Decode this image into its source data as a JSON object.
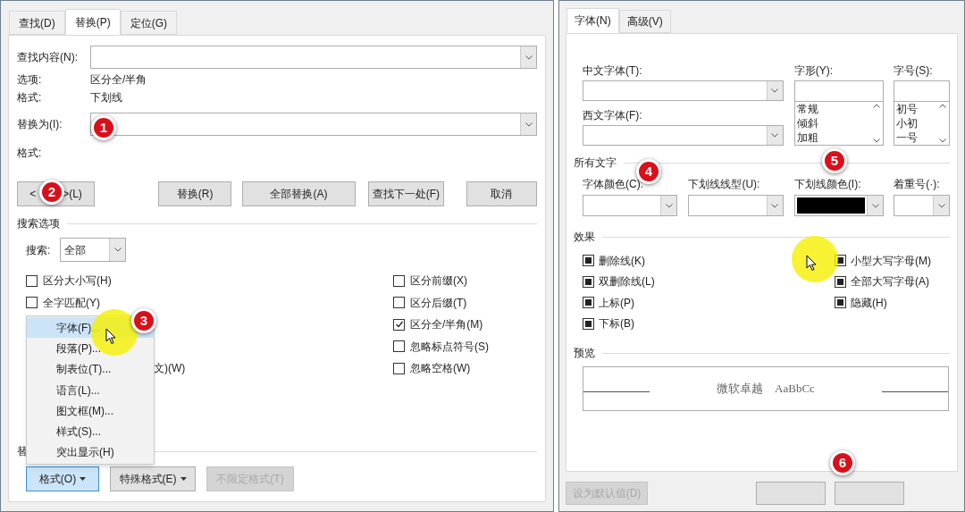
{
  "find_replace_dialog": {
    "tabs": [
      {
        "label": "查找(D)",
        "selected": false
      },
      {
        "label": "替换(P)",
        "selected": true
      },
      {
        "label": "定位(G)",
        "selected": false
      }
    ],
    "find_what": {
      "label": "查找内容(N):"
    },
    "options": {
      "label": "选项:",
      "value": "区分全/半角"
    },
    "format": {
      "label": "格式:",
      "value": "下划线"
    },
    "replace_with": {
      "label": "替换为(I):"
    },
    "replace_format": {
      "label": "格式:"
    },
    "more_button": [
      "<",
      ">(L)"
    ],
    "action_buttons": [
      "替换(R)",
      "全部替换(A)",
      "查找下一处(F)",
      "取消"
    ],
    "search_options_title": "搜索选项",
    "search": {
      "label": "搜索:",
      "value": "全部"
    },
    "left_options": [
      {
        "kind": "checkbox",
        "label": "区分大小写(H)",
        "checked": false
      },
      {
        "kind": "checkbox",
        "label": "全字匹配(Y)",
        "checked": false
      },
      {
        "kind": "partial",
        "label": "文)(W)"
      }
    ],
    "right_options": [
      {
        "label": "区分前缀(X)",
        "checked": false
      },
      {
        "label": "区分后缀(T)",
        "checked": false
      },
      {
        "label": "区分全/半角(M)",
        "checked": true
      },
      {
        "label": "忽略标点符号(S)",
        "checked": false
      },
      {
        "label": "忽略空格(W)",
        "checked": false
      }
    ],
    "replace_section_label": "替",
    "bottom_buttons": [
      {
        "label": "格式(O)",
        "kind": "menu",
        "pressed": true,
        "disabled": false
      },
      {
        "label": "特殊格式(E)",
        "kind": "menu",
        "pressed": false,
        "disabled": false
      },
      {
        "label": "不限定格式(T)",
        "kind": "plain",
        "pressed": false,
        "disabled": true
      }
    ],
    "format_menu": [
      {
        "label": "字体(F)...",
        "selected": true
      },
      {
        "label": "段落(P)...",
        "selected": false
      },
      {
        "label": "制表位(T)...",
        "selected": false
      },
      {
        "label": "语言(L)...",
        "selected": false
      },
      {
        "label": "图文框(M)...",
        "selected": false
      },
      {
        "label": "样式(S)...",
        "selected": false
      },
      {
        "label": "突出显示(H)",
        "selected": false
      }
    ]
  },
  "font_dialog": {
    "tabs": [
      {
        "label": "字体(N)",
        "selected": true
      },
      {
        "label": "高级(V)",
        "selected": false
      }
    ],
    "chinese_font": {
      "label": "中文字体(T):"
    },
    "western_font": {
      "label": "西文字体(F):"
    },
    "font_style": {
      "label": "字形(Y):",
      "options": [
        "常规",
        "倾斜",
        "加粗"
      ]
    },
    "font_size": {
      "label": "字号(S):",
      "options": [
        "初号",
        "小初",
        "一号"
      ]
    },
    "all_text_title": "所有文字",
    "font_color": {
      "label": "字体颜色(C):"
    },
    "underline_style": {
      "label": "下划线线型(U):"
    },
    "underline_color": {
      "label": "下划线颜色(I):",
      "color": "#000000"
    },
    "emphasis_mark": {
      "label": "着重号(·):"
    },
    "effects_title": "效果",
    "effects_left": [
      {
        "label": "删除线(K)",
        "indeterminate": true
      },
      {
        "label": "双删除线(L)",
        "indeterminate": true
      },
      {
        "label": "上标(P)",
        "indeterminate": true
      },
      {
        "label": "下标(B)",
        "indeterminate": true
      }
    ],
    "effects_right": [
      {
        "label": "小型大写字母(M)",
        "indeterminate": true
      },
      {
        "label": "全部大写字母(A)",
        "indeterminate": true
      },
      {
        "label": "隐藏(H)",
        "indeterminate": true
      }
    ],
    "preview_title": "预览",
    "preview_text": "微软卓越　AaBbCc",
    "footer_buttons": [
      {
        "label": "设为默认值(D)",
        "disabled": true
      },
      {
        "disabled": false
      },
      {
        "disabled": false
      }
    ]
  },
  "markers": [
    "1",
    "2",
    "3",
    "4",
    "5",
    "6"
  ]
}
